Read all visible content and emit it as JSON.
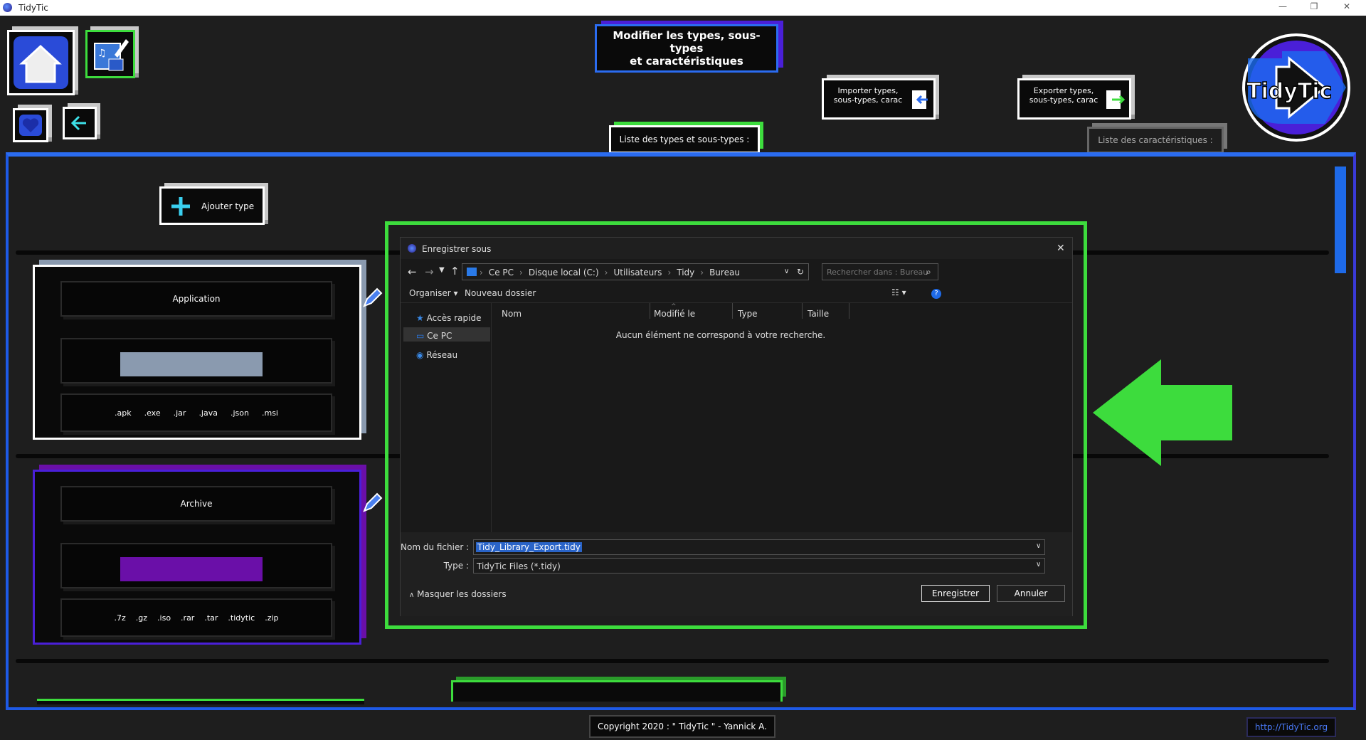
{
  "window": {
    "title": "TidyTic",
    "minimize": "—",
    "restore": "❐",
    "close": "✕"
  },
  "header": {
    "title_line1": "Modifier les types, sous-types",
    "title_line2": "et caractéristiques",
    "import_line1": "Importer types,",
    "import_line2": "sous-types, carac",
    "export_line1": "Exporter types,",
    "export_line2": "sous-types, carac",
    "tab_types": "Liste des types et sous-types :",
    "tab_carac": "Liste des caractéristiques :",
    "logo_text": "TidyTic"
  },
  "panel": {
    "add_type": "Ajouter type",
    "types": [
      {
        "name": "Application",
        "extensions": [
          ".apk",
          ".exe",
          ".jar",
          ".java",
          ".json",
          ".msi"
        ],
        "color": "#8a9aaf"
      },
      {
        "name": "Archive",
        "extensions": [
          ".7z",
          ".gz",
          ".iso",
          ".rar",
          ".tar",
          ".tidytic",
          ".zip"
        ],
        "color": "#6a0fa8"
      }
    ]
  },
  "dialog": {
    "title": "Enregistrer sous",
    "breadcrumb": [
      "Ce PC",
      "Disque local (C:)",
      "Utilisateurs",
      "Tidy",
      "Bureau"
    ],
    "search_placeholder": "Rechercher dans : Bureau",
    "toolbar": {
      "organize": "Organiser ▾",
      "new_folder": "Nouveau dossier"
    },
    "nav": [
      "Accès rapide",
      "Ce PC",
      "Réseau"
    ],
    "columns": [
      "Nom",
      "Modifié le",
      "Type",
      "Taille"
    ],
    "empty_message": "Aucun élément ne correspond à votre recherche.",
    "filename_label": "Nom du fichier :",
    "filename_value": "Tidy_Library_Export.tidy",
    "type_label": "Type :",
    "type_value": "TidyTic Files (*.tidy)",
    "hide_folders": "Masquer les dossiers",
    "save": "Enregistrer",
    "cancel": "Annuler"
  },
  "footer": {
    "copyright": "Copyright 2020 : \" TidyTic \" - Yannick A.",
    "link": "http://TidyTic.org"
  },
  "colors": {
    "accent_blue": "#2b6cf0",
    "accent_green": "#3ddc3d",
    "accent_purple": "#4a1fd8"
  }
}
